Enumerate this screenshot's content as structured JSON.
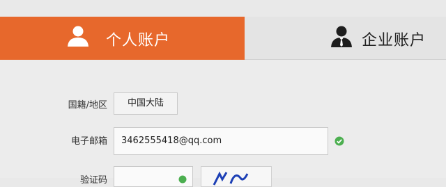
{
  "tabs": {
    "personal": {
      "label": "个人账户",
      "icon": "user-icon"
    },
    "enterprise": {
      "label": "企业账户",
      "icon": "business-user-icon"
    }
  },
  "form": {
    "region": {
      "label": "国籍/地区",
      "value": "中国大陆"
    },
    "email": {
      "label": "电子邮箱",
      "value": "3462555418@qq.com",
      "status_icon": "check-circle-icon"
    },
    "captcha": {
      "label": "验证码"
    }
  },
  "colors": {
    "accent": "#e7682c",
    "success": "#4caf50"
  }
}
